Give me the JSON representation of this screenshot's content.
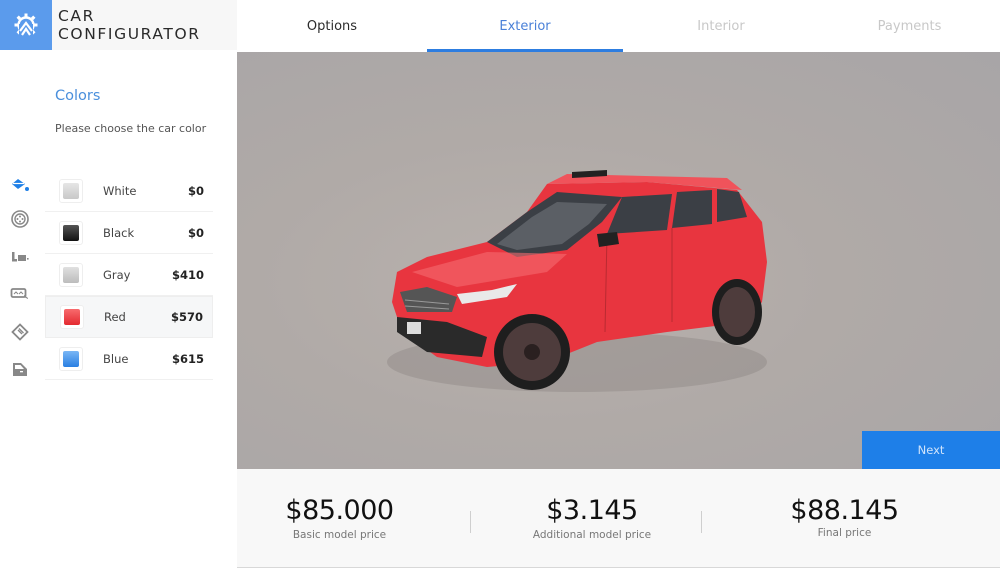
{
  "header": {
    "brand_title": "CAR CONFIGURATOR",
    "logo_icon": "gear-tree-logo-icon",
    "tabs": [
      {
        "label": "Options",
        "state": "completed"
      },
      {
        "label": "Exterior",
        "state": "active"
      },
      {
        "label": "Interior",
        "state": "disabled"
      },
      {
        "label": "Payments",
        "state": "disabled"
      }
    ]
  },
  "sidebar": {
    "section_title": "Colors",
    "section_subtitle": "Please choose the car color",
    "rail_icons": [
      {
        "name": "paint-bucket-icon",
        "active": true
      },
      {
        "name": "wheel-icon",
        "active": false
      },
      {
        "name": "seat-icon",
        "active": false
      },
      {
        "name": "dashboard-icon",
        "active": false
      },
      {
        "name": "tag-icon",
        "active": false
      },
      {
        "name": "car-door-icon",
        "active": false
      }
    ],
    "colors": [
      {
        "name": "White",
        "price": "$0",
        "swatch": "#d9d9d9",
        "selected": false
      },
      {
        "name": "Black",
        "price": "$0",
        "swatch": "#1a1a1a",
        "selected": false
      },
      {
        "name": "Gray",
        "price": "$410",
        "swatch": "#c9c9c9",
        "selected": false
      },
      {
        "name": "Red",
        "price": "$570",
        "swatch": "#ef3a3f",
        "selected": true
      },
      {
        "name": "Blue",
        "price": "$615",
        "swatch": "#3d8ce8",
        "selected": false
      }
    ]
  },
  "viewport": {
    "car_color": "#e8353f",
    "next_label": "Next"
  },
  "prices": {
    "basic": {
      "value": "$85.000",
      "label": "Basic model price"
    },
    "additional": {
      "value": "$3.145",
      "label": "Additional model price"
    },
    "final": {
      "value": "$88.145",
      "label": "Final price"
    }
  },
  "colors": {
    "accent": "#2d7de0",
    "logo_bg": "#5b9bec",
    "next_bg": "#1e7fe8"
  }
}
